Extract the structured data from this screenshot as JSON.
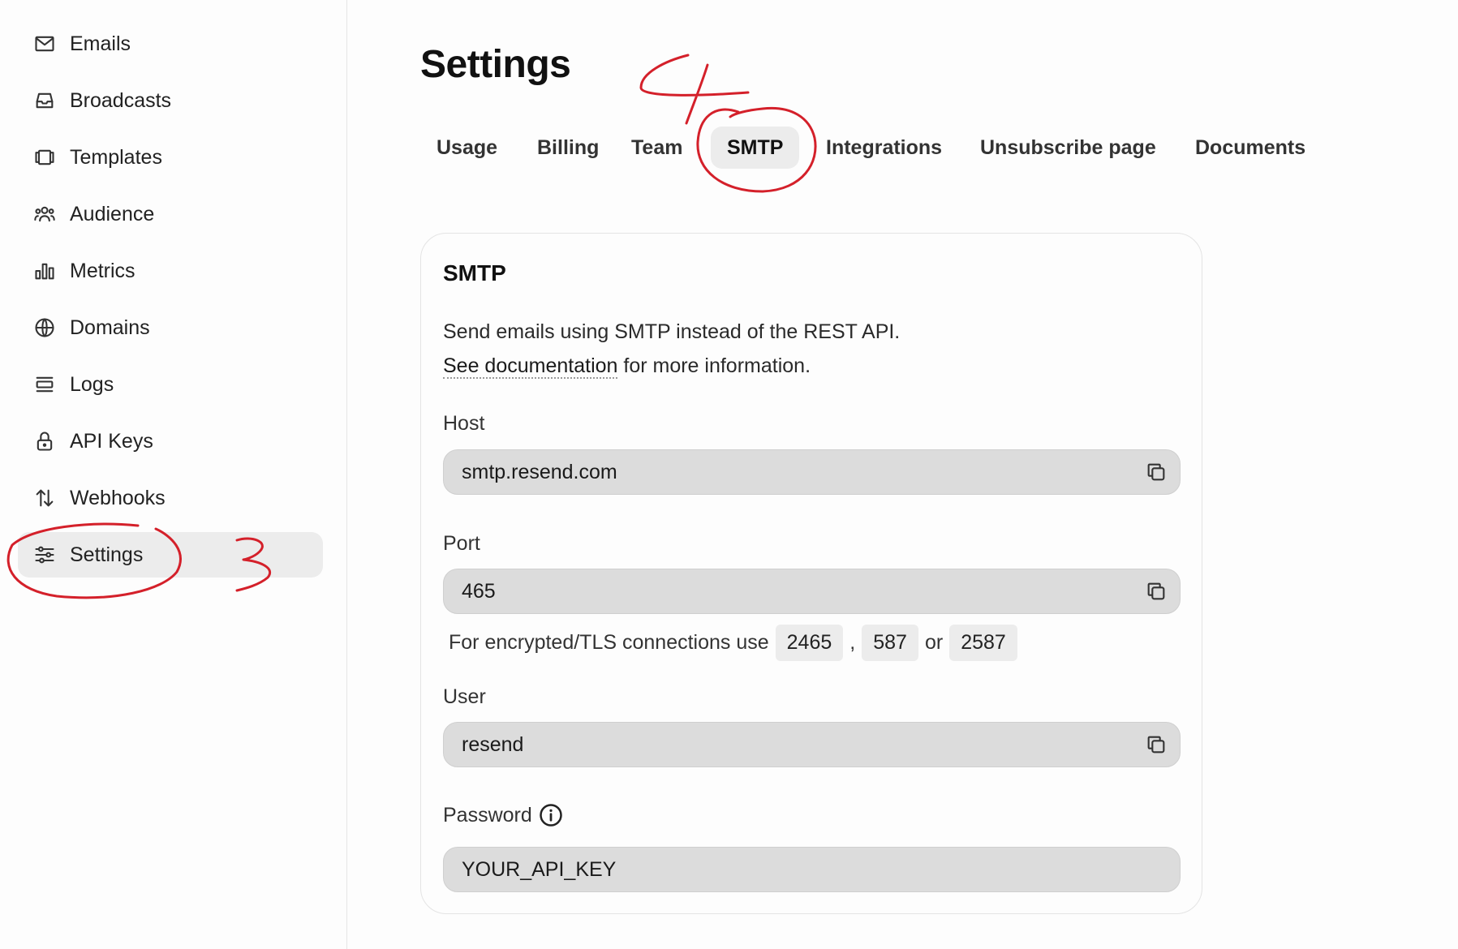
{
  "sidebar": {
    "items": [
      {
        "label": "Emails",
        "icon": "mail-icon"
      },
      {
        "label": "Broadcasts",
        "icon": "inbox-icon"
      },
      {
        "label": "Templates",
        "icon": "templates-icon"
      },
      {
        "label": "Audience",
        "icon": "users-icon"
      },
      {
        "label": "Metrics",
        "icon": "bar-chart-icon"
      },
      {
        "label": "Domains",
        "icon": "globe-icon"
      },
      {
        "label": "Logs",
        "icon": "list-icon"
      },
      {
        "label": "API Keys",
        "icon": "lock-icon"
      },
      {
        "label": "Webhooks",
        "icon": "arrows-icon"
      },
      {
        "label": "Settings",
        "icon": "sliders-icon",
        "active": true
      }
    ]
  },
  "main": {
    "title": "Settings",
    "tabs": [
      {
        "label": "Usage"
      },
      {
        "label": "Billing"
      },
      {
        "label": "Team"
      },
      {
        "label": "SMTP",
        "active": true
      },
      {
        "label": "Integrations"
      },
      {
        "label": "Unsubscribe page"
      },
      {
        "label": "Documents"
      }
    ]
  },
  "smtp": {
    "title": "SMTP",
    "description": "Send emails using SMTP instead of the REST API.",
    "doc_link": "See documentation",
    "doc_suffix": " for more information.",
    "host_label": "Host",
    "host_value": "smtp.resend.com",
    "port_label": "Port",
    "port_value": "465",
    "tls_prefix": "For encrypted/TLS connections use",
    "tls_ports": [
      "2465",
      "587",
      "2587"
    ],
    "tls_sep_comma": ",",
    "tls_sep_or": "or",
    "user_label": "User",
    "user_value": "resend",
    "password_label": "Password",
    "password_value": "YOUR_API_KEY"
  },
  "annotations": {
    "color": "#d4202a",
    "marks": [
      "3",
      "4"
    ]
  }
}
